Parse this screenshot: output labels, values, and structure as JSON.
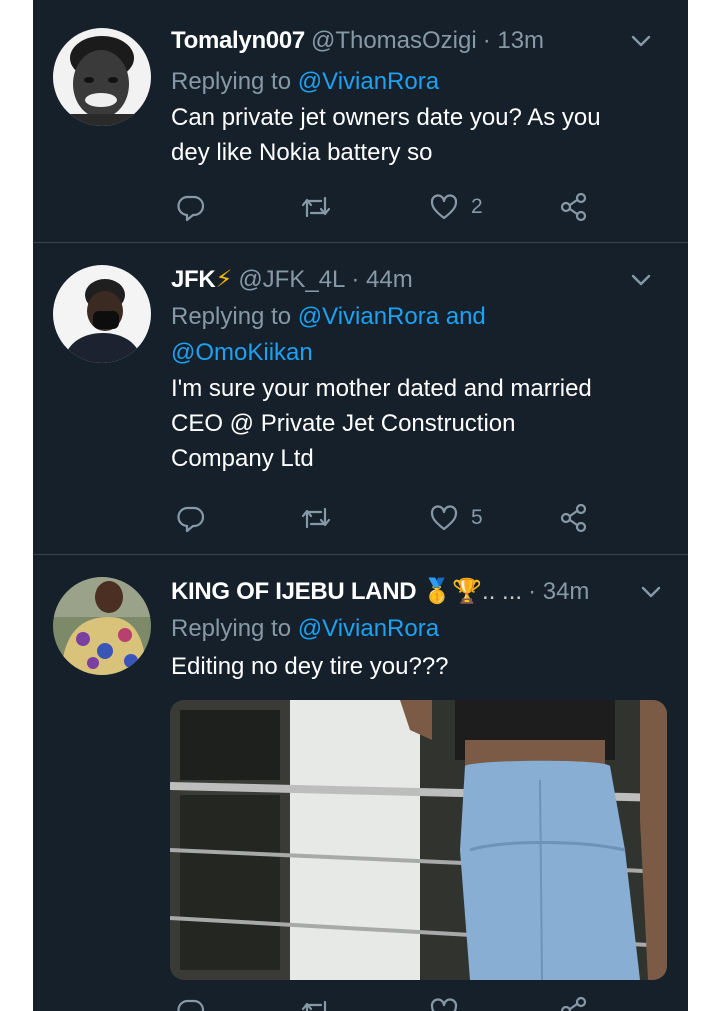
{
  "tweets": [
    {
      "name": "Tomalyn007",
      "handle": "@ThomasOzigi",
      "time": "· 13m",
      "reply_prefix": "Replying to",
      "reply_to": "@VivianRora",
      "reply_line2": "",
      "body": [
        "Can private jet owners date you? As you",
        "dey like Nokia battery so"
      ],
      "likes": "2"
    },
    {
      "name": "JFK",
      "badge": "⚡",
      "handle": "@JFK_4L",
      "time": "· 44m",
      "reply_prefix": "Replying to",
      "reply_to": "@VivianRora and",
      "reply_line2": "@OmoKiikan",
      "body": [
        "I'm sure your mother dated and married",
        "CEO @ Private Jet Construction",
        "Company Ltd"
      ],
      "likes": "5"
    },
    {
      "name": "KING OF IJEBU LAND",
      "badge": "🥇🏆.. ...",
      "time": "· 34m",
      "reply_prefix": "Replying to",
      "reply_to": "@VivianRora",
      "body": [
        "Editing no dey tire you???"
      ]
    }
  ],
  "icons": {
    "reply": "reply-icon",
    "retweet": "retweet-icon",
    "like": "heart-icon",
    "share": "share-icon",
    "more": "chevron-down-icon"
  },
  "colors": {
    "background": "#15202b",
    "divider": "#38444d",
    "muted": "#8899a6",
    "link": "#1da1f2",
    "text": "#ffffff"
  }
}
